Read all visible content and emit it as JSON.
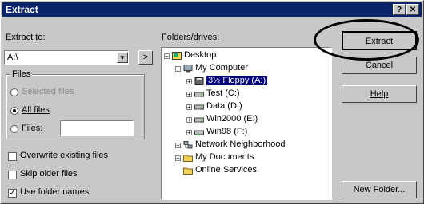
{
  "window": {
    "title": "Extract",
    "help_btn": "?",
    "close_btn": "✕"
  },
  "extract_to": {
    "label": "Extract to:",
    "value": "A:\\",
    "arrow": "▼",
    "browse": ">"
  },
  "files_group": {
    "title": "Files",
    "selected_files": "Selected files",
    "all_files": "All files",
    "files": "Files:",
    "files_value": ""
  },
  "options": {
    "overwrite": {
      "label": "Overwrite existing files",
      "checked": false
    },
    "skip_older": {
      "label": "Skip older files",
      "checked": false
    },
    "use_folder_names": {
      "label": "Use folder names",
      "checked": true
    }
  },
  "folders": {
    "label": "Folders/drives:",
    "tree": [
      {
        "label": "Desktop",
        "icon": "desktop-icon"
      },
      {
        "label": "My Computer",
        "icon": "computer-icon"
      },
      {
        "label": "3½ Floppy (A:)",
        "icon": "floppy-icon"
      },
      {
        "label": "Test (C:)",
        "icon": "drive-icon"
      },
      {
        "label": "Data (D:)",
        "icon": "drive-icon"
      },
      {
        "label": "Win2000 (E:)",
        "icon": "drive-icon"
      },
      {
        "label": "Win98 (F:)",
        "icon": "shared-drive-icon"
      },
      {
        "label": "Network Neighborhood",
        "icon": "network-icon"
      },
      {
        "label": "My Documents",
        "icon": "folder-icon"
      },
      {
        "label": "Online Services",
        "icon": "folder-icon"
      }
    ]
  },
  "buttons": {
    "extract": "Extract",
    "cancel": "Cancel",
    "help": "Help",
    "new_folder": "New Folder..."
  }
}
